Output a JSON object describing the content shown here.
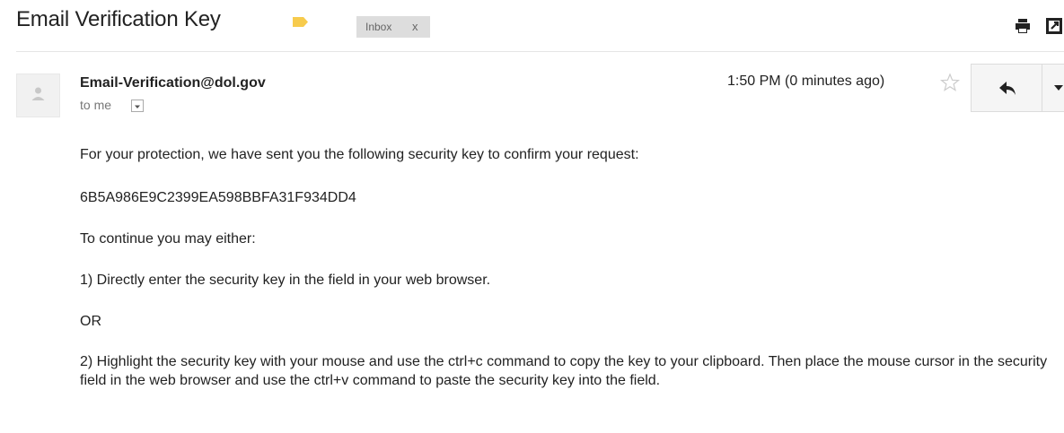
{
  "header": {
    "subject": "Email Verification Key",
    "label_chip": "Inbox",
    "label_chip_close": "x",
    "label_color": "#f7cb4d"
  },
  "message": {
    "sender": "Email-Verification@dol.gov",
    "recipient": "to me",
    "time": "1:50 PM (0 minutes ago)",
    "body": {
      "line1": "For your protection, we have sent you the following security key to confirm your request:",
      "key": "6B5A986E9C2399EA598BBFA31F934DD4",
      "line3": "To continue you may either:",
      "option1": "1) Directly enter the security key in the field in your web browser.",
      "or": "OR",
      "option2": "2) Highlight the security key with your mouse and use the ctrl+c command to copy the key to your clipboard. Then place the mouse cursor in the security field in the web browser and use the ctrl+v command to paste the security key into the field."
    }
  },
  "icons": {
    "label": "label-tag-icon",
    "print": "print-icon",
    "popout": "new-window-icon",
    "star": "star-icon",
    "reply": "reply-icon",
    "more": "chevron-down-icon",
    "avatar": "person-icon"
  }
}
